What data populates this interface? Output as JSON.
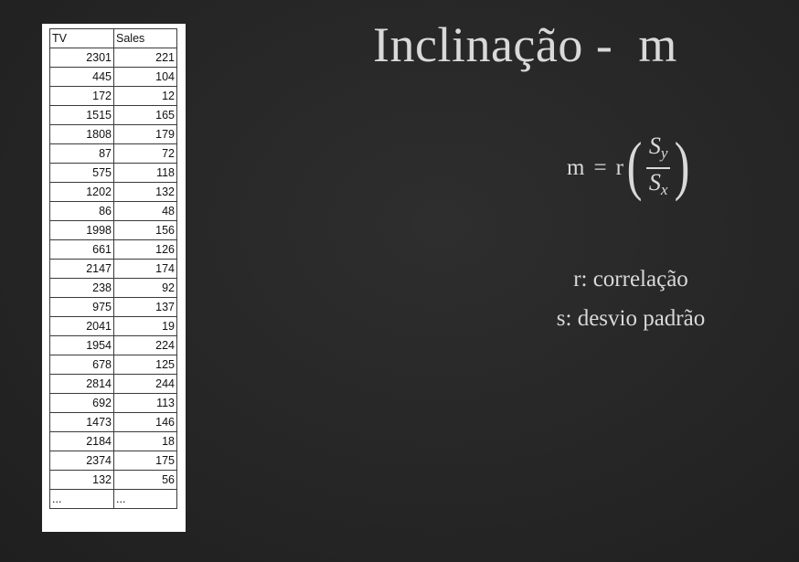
{
  "table": {
    "headers": [
      "TV",
      "Sales"
    ],
    "rows": [
      [
        "2301",
        "221"
      ],
      [
        "445",
        "104"
      ],
      [
        "172",
        "12"
      ],
      [
        "1515",
        "165"
      ],
      [
        "1808",
        "179"
      ],
      [
        "87",
        "72"
      ],
      [
        "575",
        "118"
      ],
      [
        "1202",
        "132"
      ],
      [
        "86",
        "48"
      ],
      [
        "1998",
        "156"
      ],
      [
        "661",
        "126"
      ],
      [
        "2147",
        "174"
      ],
      [
        "238",
        "92"
      ],
      [
        "975",
        "137"
      ],
      [
        "2041",
        "19"
      ],
      [
        "1954",
        "224"
      ],
      [
        "678",
        "125"
      ],
      [
        "2814",
        "244"
      ],
      [
        "692",
        "113"
      ],
      [
        "1473",
        "146"
      ],
      [
        "2184",
        "18"
      ],
      [
        "2374",
        "175"
      ],
      [
        "132",
        "56"
      ]
    ],
    "ellipsis": [
      "...",
      "..."
    ]
  },
  "title": "Inclinação -  m",
  "formula": {
    "lhs": "m",
    "equals": "=",
    "r": "r",
    "numerator": "S",
    "numerator_sub": "y",
    "denominator": "S",
    "denominator_sub": "x",
    "open_paren": "(",
    "close_paren": ")"
  },
  "legend": {
    "line1": "r: correlação",
    "line2": "s: desvio padrão"
  },
  "colors": {
    "background": "#272727",
    "text": "#d9d9d9",
    "table_bg": "#ffffff"
  }
}
